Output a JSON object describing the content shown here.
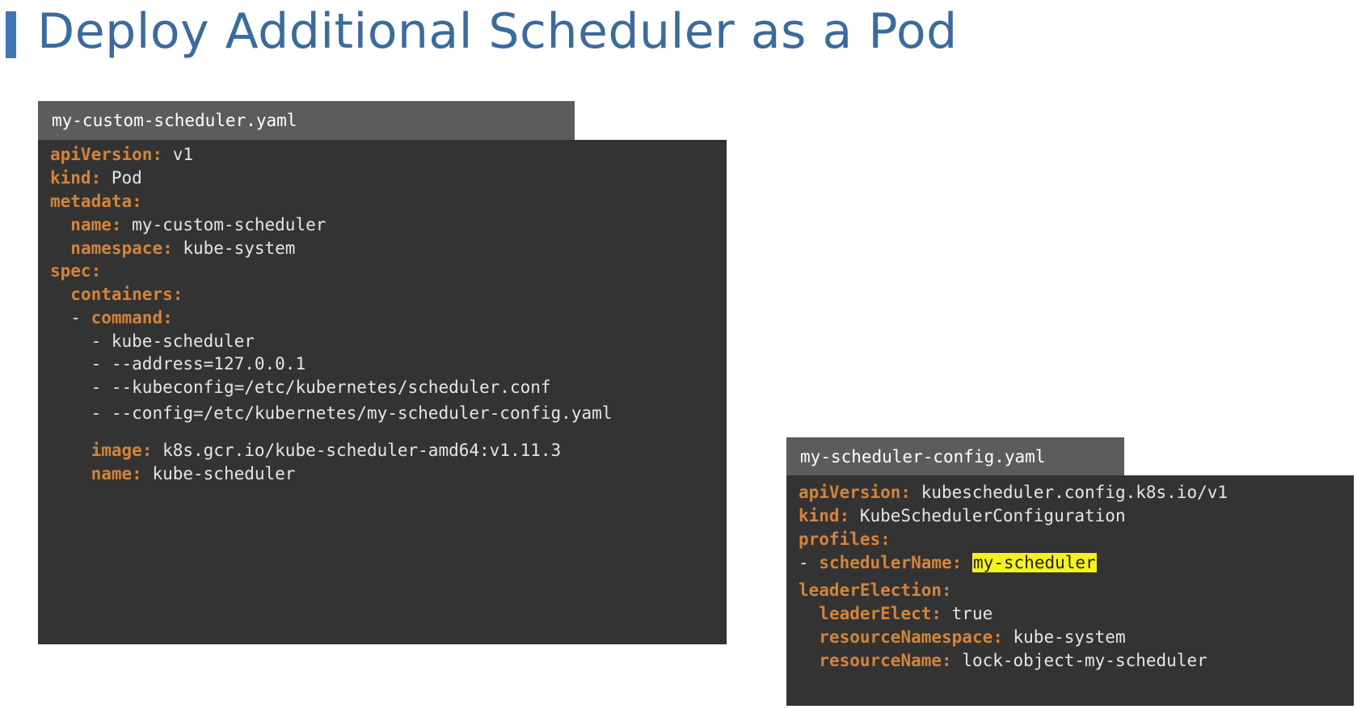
{
  "slide": {
    "title": "Deploy Additional Scheduler as a Pod"
  },
  "custom_scheduler_file": {
    "filename": "my-custom-scheduler.yaml",
    "lines": [
      {
        "indent": "",
        "dash": "",
        "key": "apiVersion:",
        "value": " v1"
      },
      {
        "indent": "",
        "dash": "",
        "key": "kind:",
        "value": " Pod"
      },
      {
        "indent": "",
        "dash": "",
        "key": "metadata:",
        "value": ""
      },
      {
        "indent": "  ",
        "dash": "",
        "key": "name:",
        "value": " my-custom-scheduler"
      },
      {
        "indent": "  ",
        "dash": "",
        "key": "namespace:",
        "value": " kube-system"
      },
      {
        "indent": "",
        "dash": "",
        "key": "spec:",
        "value": ""
      },
      {
        "indent": "  ",
        "dash": "",
        "key": "containers:",
        "value": ""
      },
      {
        "indent": "  ",
        "dash": "- ",
        "key": "command:",
        "value": ""
      },
      {
        "indent": "    ",
        "dash": "- ",
        "key": "",
        "value": "kube-scheduler"
      },
      {
        "indent": "    ",
        "dash": "- ",
        "key": "",
        "value": "--address=127.0.0.1"
      },
      {
        "indent": "    ",
        "dash": "- ",
        "key": "",
        "value": "--kubeconfig=/etc/kubernetes/scheduler.conf"
      },
      {
        "indent": "    ",
        "dash": "- ",
        "key": "",
        "value": "--config=/etc/kubernetes/my-scheduler-config.yaml"
      },
      {
        "indent": "    ",
        "dash": "",
        "key": "image:",
        "value": " k8s.gcr.io/kube-scheduler-amd64:v1.11.3"
      },
      {
        "indent": "    ",
        "dash": "",
        "key": "name:",
        "value": " kube-scheduler"
      }
    ]
  },
  "scheduler_config_file": {
    "filename": "my-scheduler-config.yaml",
    "lines": [
      {
        "indent": "",
        "dash": "",
        "key": "apiVersion:",
        "value": " kubescheduler.config.k8s.io/v1",
        "highlight": ""
      },
      {
        "indent": "",
        "dash": "",
        "key": "kind:",
        "value": " KubeSchedulerConfiguration",
        "highlight": ""
      },
      {
        "indent": "",
        "dash": "",
        "key": "profiles:",
        "value": "",
        "highlight": ""
      },
      {
        "indent": "",
        "dash": "- ",
        "key": "schedulerName:",
        "value": " ",
        "highlight": "my-scheduler"
      },
      {
        "indent": "",
        "dash": "",
        "key": "leaderElection:",
        "value": "",
        "highlight": ""
      },
      {
        "indent": "  ",
        "dash": "",
        "key": "leaderElect:",
        "value": " true",
        "highlight": ""
      },
      {
        "indent": "  ",
        "dash": "",
        "key": "resourceNamespace:",
        "value": " kube-system",
        "highlight": ""
      },
      {
        "indent": "  ",
        "dash": "",
        "key": "resourceName:",
        "value": " lock-object-my-scheduler",
        "highlight": ""
      }
    ],
    "highlight_color": "#f4f21f"
  },
  "colors": {
    "title": "#3b6b9e",
    "accent_bar": "#3f78b5",
    "yaml_key": "#d4843a",
    "yaml_value": "#e6e6e6",
    "panel_bg": "#333333",
    "tab_bg": "#5c5c5c"
  }
}
